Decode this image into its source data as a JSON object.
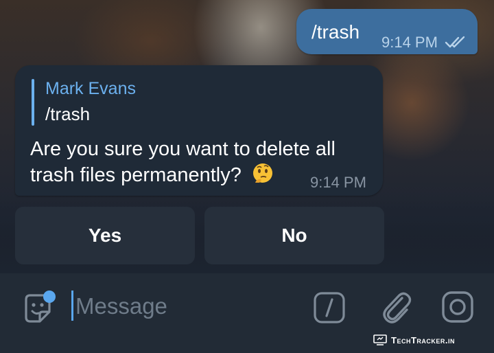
{
  "outgoing": {
    "text": "/trash",
    "time": "9:14 PM",
    "status_icon": "double-check-icon"
  },
  "incoming": {
    "reply_name": "Mark Evans",
    "reply_text": "/trash",
    "message": "Are you sure you want to delete all trash files permanently?",
    "emoji": "thinking-face-icon",
    "time": "9:14 PM"
  },
  "keyboard": {
    "yes_label": "Yes",
    "no_label": "No"
  },
  "composer": {
    "placeholder": "Message",
    "icons": [
      "sticker-icon",
      "command-icon",
      "attach-icon",
      "camera-icon"
    ]
  },
  "watermark": {
    "text": "TechTracker.in"
  },
  "colors": {
    "outgoing_bubble": "#3d6e9e",
    "incoming_bubble": "#1f2a37",
    "accent": "#6cb1ef",
    "input_bar": "#222b36"
  }
}
